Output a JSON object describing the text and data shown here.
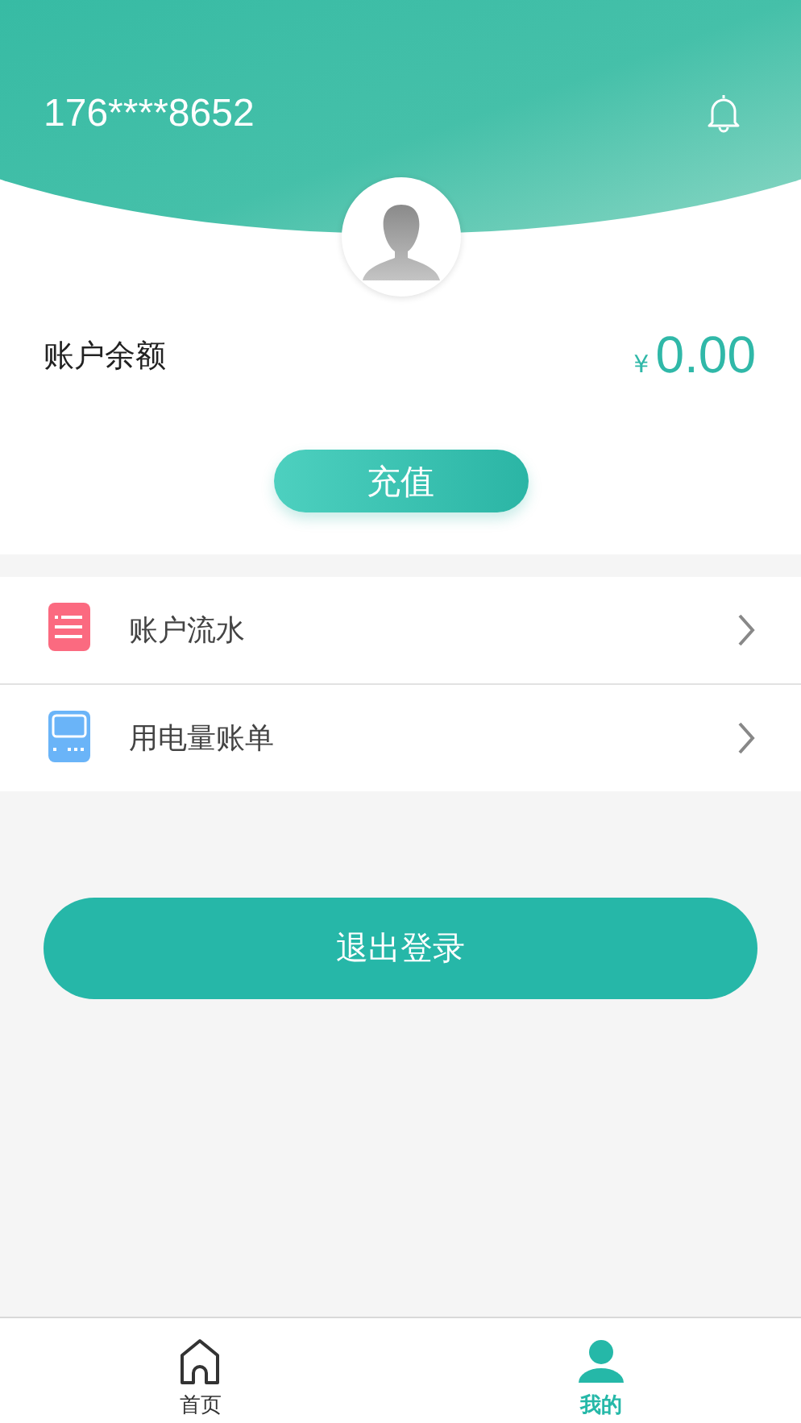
{
  "header": {
    "phone": "176****8652"
  },
  "balance": {
    "label": "账户余额",
    "currency": "¥",
    "amount": "0.00"
  },
  "recharge_button": "充值",
  "menu": [
    {
      "kind": "list",
      "label": "账户流水"
    },
    {
      "kind": "meter",
      "label": "用电量账单"
    }
  ],
  "logout_button": "退出登录",
  "tabs": [
    {
      "kind": "home",
      "label": "首页",
      "selected": false
    },
    {
      "kind": "user",
      "label": "我的",
      "selected": true
    }
  ]
}
